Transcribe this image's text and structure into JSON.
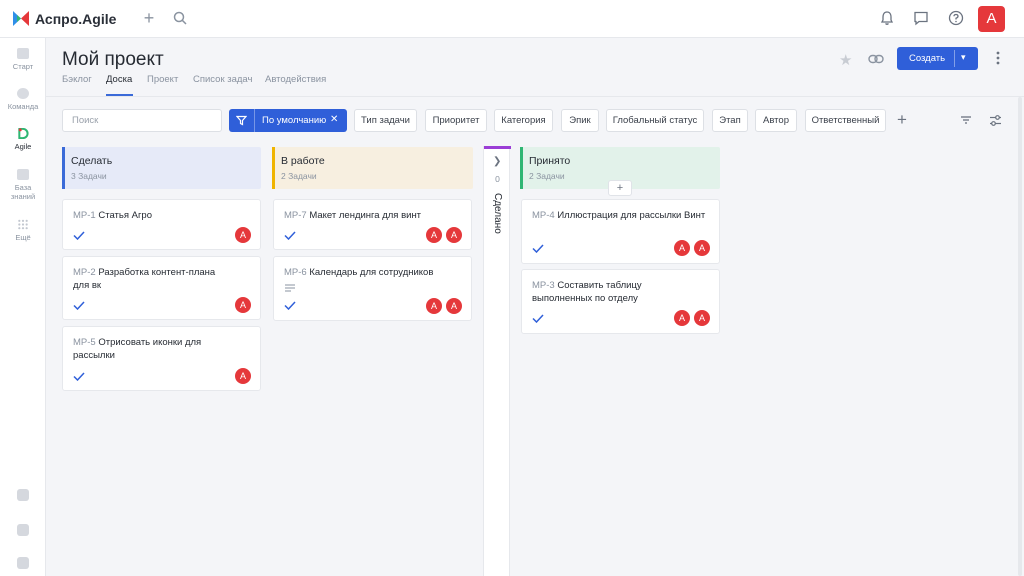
{
  "app": {
    "title": "Аспро.Agile",
    "user_initial": "A"
  },
  "sidebar": {
    "items": [
      {
        "label": "Старт"
      },
      {
        "label": "Команда"
      },
      {
        "label": "Agile"
      },
      {
        "label": "База знаний"
      },
      {
        "label": "Ещё"
      }
    ]
  },
  "header": {
    "title": "Мой проект",
    "tabs": [
      "Бэклог",
      "Доска",
      "Проект",
      "Список задач",
      "Автодействия"
    ],
    "active_tab": "Доска",
    "create_label": "Создать"
  },
  "filters": {
    "search_placeholder": "Поиск",
    "default_label": "По умолчанию",
    "chips": [
      "Тип задачи",
      "Приоритет",
      "Категория",
      "Эпик",
      "Глобальный статус",
      "Этап",
      "Автор",
      "Ответственный"
    ]
  },
  "columns": [
    {
      "name": "Сделать",
      "count": "3 Задачи",
      "accent": "#3a6ad8",
      "bg": "#e6eaf8",
      "cards": [
        {
          "key": "MP-1",
          "title": "Статья Агро",
          "assignees": [
            "A"
          ]
        },
        {
          "key": "MP-2",
          "title": "Разработка контент-плана для вк",
          "assignees": [
            "A"
          ]
        },
        {
          "key": "MP-5",
          "title": "Отрисовать иконки для рассылки",
          "assignees": [
            "A"
          ]
        }
      ]
    },
    {
      "name": "В работе",
      "count": "2 Задачи",
      "accent": "#f0b400",
      "bg": "#f7efe0",
      "cards": [
        {
          "key": "MP-7",
          "title": "Макет лендинга для винт",
          "assignees": [
            "A",
            "A"
          ]
        },
        {
          "key": "MP-6",
          "title": "Календарь для сотрудников",
          "assignees": [
            "A",
            "A"
          ]
        }
      ]
    },
    {
      "name": "Сделано",
      "count": "0",
      "accent": "#9b3ed6",
      "collapsed": true
    },
    {
      "name": "Принято",
      "count": "2 Задачи",
      "accent": "#2fb673",
      "bg": "#e2f2ea",
      "cards": [
        {
          "key": "MP-4",
          "title": "Иллюстрация для рассылки Винт",
          "assignees": [
            "A",
            "A"
          ]
        },
        {
          "key": "MP-3",
          "title": "Составить таблицу выполненных по отделу",
          "assignees": [
            "A",
            "A"
          ]
        }
      ]
    }
  ],
  "add_card_symbol": "+"
}
